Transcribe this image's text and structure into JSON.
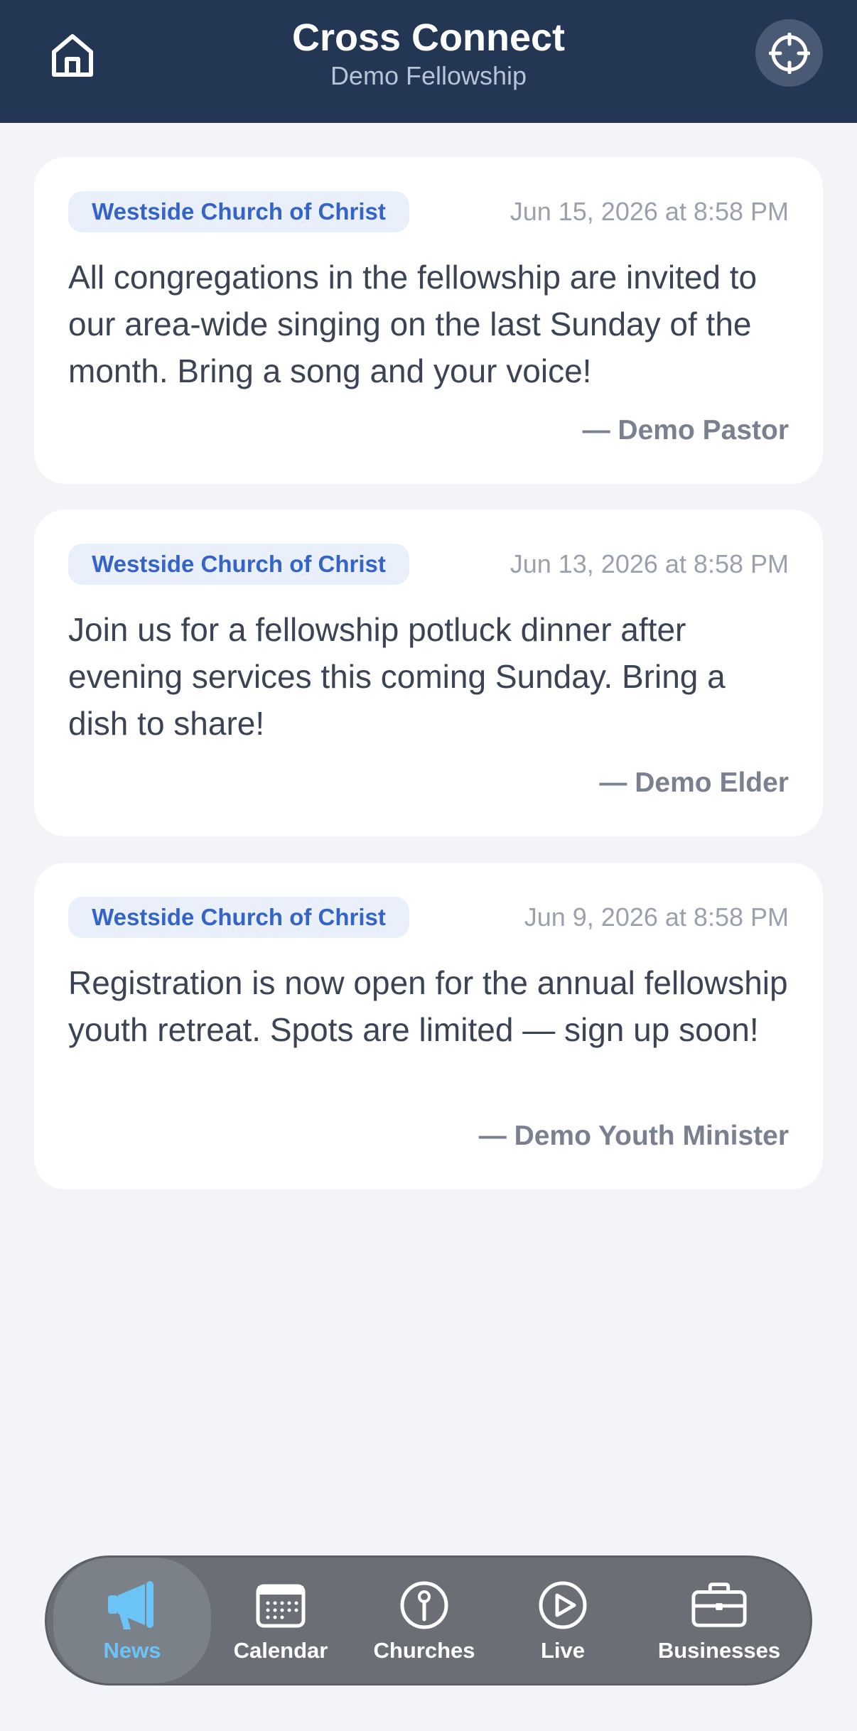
{
  "header": {
    "title": "Cross Connect",
    "subtitle": "Demo Fellowship",
    "home_icon": "home-icon",
    "locate_icon": "crosshair-icon"
  },
  "posts": [
    {
      "church": "Westside Church of Christ",
      "date": "Jun 15, 2026 at 8:58 PM",
      "body": "All congregations in the fellowship are invited to our area-wide singing on the last Sunday of the month. Bring a song and your voice!",
      "author": "— Demo Pastor"
    },
    {
      "church": "Westside Church of Christ",
      "date": "Jun 13, 2026 at 8:58 PM",
      "body": "Join us for a fellowship potluck dinner after evening services this coming Sunday. Bring a dish to share!",
      "author": "— Demo Elder"
    },
    {
      "church": "Westside Church of Christ",
      "date": "Jun 9, 2026 at 8:58 PM",
      "body": "Registration is now open for the annual fellowship youth retreat. Spots are limited — sign up soon!",
      "author": "— Demo Youth Minister"
    }
  ],
  "nav": {
    "items": [
      {
        "label": "News",
        "icon": "megaphone-icon",
        "active": true
      },
      {
        "label": "Calendar",
        "icon": "calendar-icon",
        "active": false
      },
      {
        "label": "Churches",
        "icon": "map-pin-icon",
        "active": false
      },
      {
        "label": "Live",
        "icon": "play-icon",
        "active": false
      },
      {
        "label": "Businesses",
        "icon": "briefcase-icon",
        "active": false
      }
    ]
  },
  "colors": {
    "header_bg": "#233654",
    "accent_tag": "#3564c9",
    "active_nav": "#6cc3f5",
    "page_bg": "#f2f4f8"
  }
}
